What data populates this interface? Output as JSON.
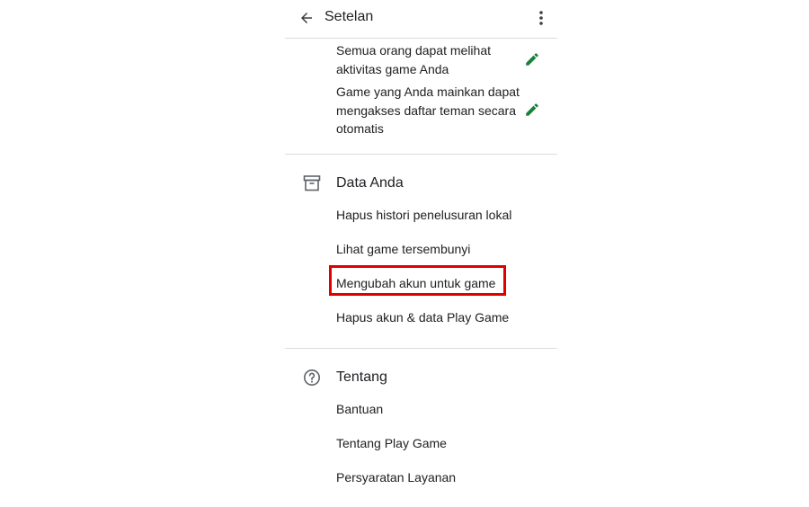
{
  "header": {
    "title": "Setelan",
    "back_icon": "arrow-back-icon",
    "menu_icon": "more-vert-icon"
  },
  "profile_section": {
    "items": [
      {
        "lines": [
          "Semua orang dapat melihat",
          "aktivitas game Anda"
        ],
        "icon": "pencil-icon"
      },
      {
        "lines": [
          "Game yang Anda mainkan dapat",
          "mengakses daftar teman secara",
          "otomatis"
        ],
        "icon": "pencil-icon"
      }
    ]
  },
  "data_section": {
    "title": "Data Anda",
    "icon": "archive-box-icon",
    "items": [
      "Hapus histori penelusuran lokal",
      "Lihat game tersembunyi",
      "Mengubah akun untuk game",
      "Hapus akun & data Play Game"
    ]
  },
  "about_section": {
    "title": "Tentang",
    "icon": "help-circle-icon",
    "items": [
      "Bantuan",
      "Tentang Play Game",
      "Persyaratan Layanan"
    ]
  },
  "colors": {
    "accent_green": "#188038",
    "highlight_red": "#e00000",
    "divider": "#dadce0",
    "text": "#202124",
    "icon_gray": "#5f6368"
  }
}
